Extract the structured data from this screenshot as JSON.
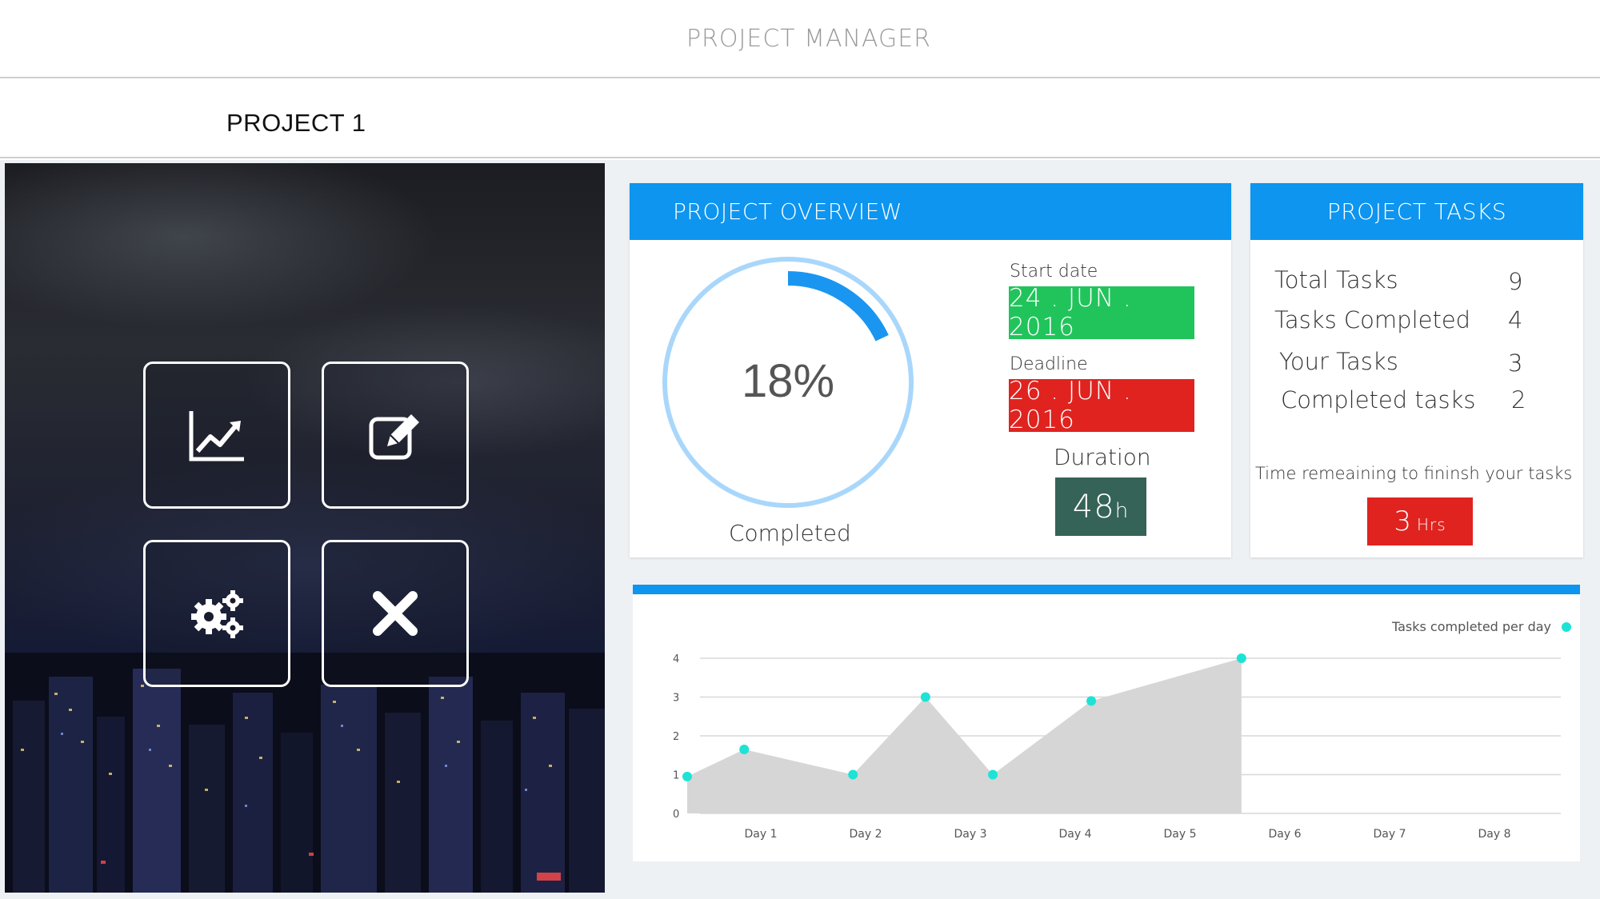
{
  "app": {
    "title": "PROJECT MANAGER"
  },
  "project": {
    "name": "PROJECT 1"
  },
  "tiles": [
    {
      "name": "analytics-tile",
      "icon": "line-chart-icon"
    },
    {
      "name": "edit-tile",
      "icon": "edit-icon"
    },
    {
      "name": "settings-tile",
      "icon": "gears-icon"
    },
    {
      "name": "delete-tile",
      "icon": "close-icon"
    }
  ],
  "overview": {
    "header": "PROJECT OVERVIEW",
    "progress_percent": 18,
    "progress_label": "18%",
    "completed_label": "Completed",
    "start_label": "Start date",
    "start_value": "24 . JUN . 2016",
    "deadline_label": "Deadline",
    "deadline_value": "26 . JUN . 2016",
    "duration_label": "Duration",
    "duration_value": "48",
    "duration_unit": "h"
  },
  "tasks": {
    "header": "PROJECT TASKS",
    "rows": [
      {
        "label": "Total Tasks",
        "value": "9"
      },
      {
        "label": "Tasks Completed",
        "value": "4"
      },
      {
        "label": "Your Tasks",
        "value": "3"
      },
      {
        "label": "Completed tasks",
        "value": "2"
      }
    ],
    "remaining_label": "Time remeaining to fininsh your tasks",
    "remaining_value": "3",
    "remaining_unit": "Hrs"
  },
  "colors": {
    "accent": "#0d95f0",
    "start_green": "#21c45b",
    "deadline_red": "#e0231f",
    "duration_teal": "#356357",
    "point_cyan": "#1de3d6",
    "area_gray": "#d6d6d6"
  },
  "chart_data": {
    "type": "area",
    "legend": "Tasks completed per day",
    "legend_position": "top-right",
    "categories": [
      "Day 1",
      "Day 2",
      "Day 3",
      "Day 4",
      "Day 5",
      "Day 6",
      "Day 7",
      "Day 8"
    ],
    "y_ticks": [
      "0",
      "1",
      "2",
      "3",
      "4"
    ],
    "ylim": [
      0,
      4
    ],
    "grid": true,
    "points": [
      {
        "x": 0.0,
        "y": 0.95
      },
      {
        "x": 0.55,
        "y": 1.65
      },
      {
        "x": 1.6,
        "y": 1.0
      },
      {
        "x": 2.3,
        "y": 3.0
      },
      {
        "x": 2.95,
        "y": 1.0
      },
      {
        "x": 3.9,
        "y": 2.9
      },
      {
        "x": 5.35,
        "y": 4.0
      }
    ]
  }
}
